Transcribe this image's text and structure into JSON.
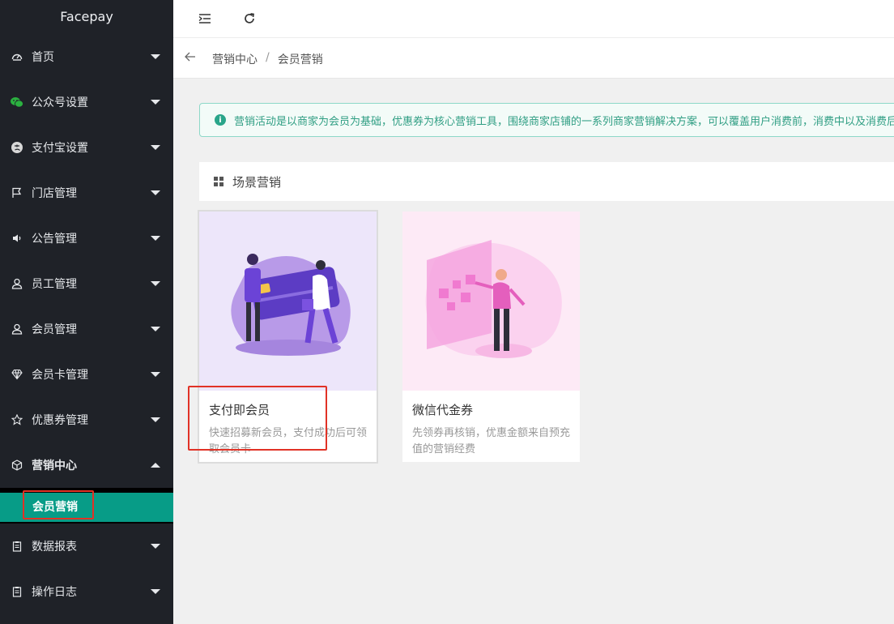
{
  "app": {
    "name": "Facepay"
  },
  "sidebar": {
    "items": [
      {
        "label": "首页",
        "icon": "dashboard-icon"
      },
      {
        "label": "公众号设置",
        "icon": "wechat-icon"
      },
      {
        "label": "支付宝设置",
        "icon": "alipay-icon"
      },
      {
        "label": "门店管理",
        "icon": "flag-icon"
      },
      {
        "label": "公告管理",
        "icon": "speaker-icon"
      },
      {
        "label": "员工管理",
        "icon": "user-icon"
      },
      {
        "label": "会员管理",
        "icon": "user-icon"
      },
      {
        "label": "会员卡管理",
        "icon": "diamond-icon"
      },
      {
        "label": "优惠券管理",
        "icon": "star-icon"
      },
      {
        "label": "营销中心",
        "icon": "cube-icon"
      },
      {
        "label": "数据报表",
        "icon": "clipboard-icon"
      },
      {
        "label": "操作日志",
        "icon": "clipboard-icon"
      }
    ],
    "active_sub": "会员营销"
  },
  "breadcrumb": {
    "parent": "营销中心",
    "separator": "/",
    "current": "会员营销"
  },
  "alert": {
    "text": "营销活动是以商家为会员为基础，优惠券为核心营销工具，围绕商家店铺的一系列商家营销解决方案，可以覆盖用户消费前，消费中以及消费后"
  },
  "section": {
    "title": "场景营销"
  },
  "cards": [
    {
      "title": "支付即会员",
      "desc": "快速招募新会员，支付成功后可领取会员卡"
    },
    {
      "title": "微信代金券",
      "desc": "先领券再核销，优惠金额来自预充值的营销经费"
    }
  ],
  "colors": {
    "sidebar_bg": "#1f2228",
    "accent": "#079c87",
    "highlight": "#e13226"
  }
}
